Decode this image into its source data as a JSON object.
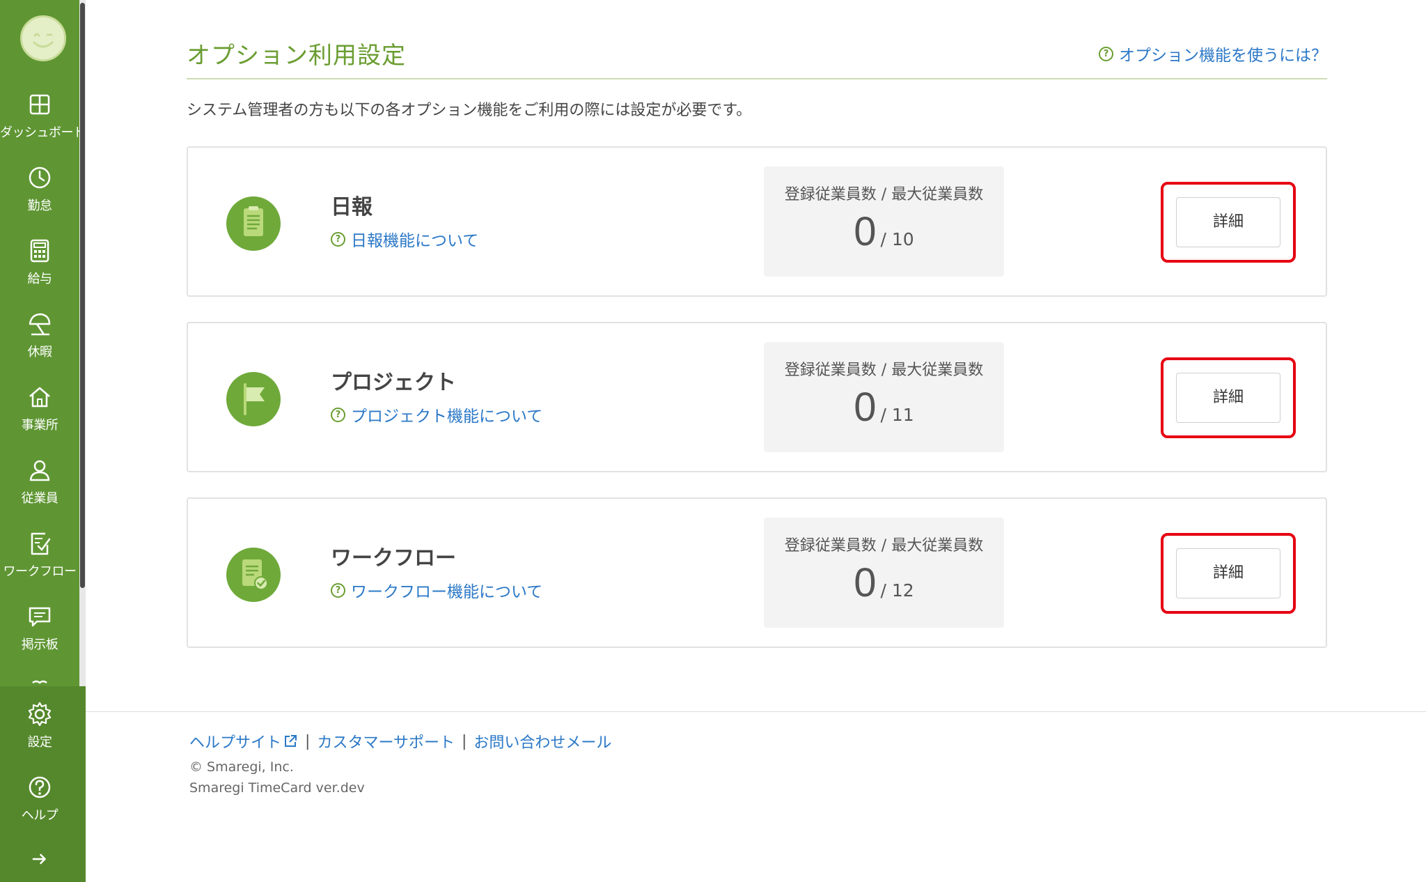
{
  "sidebar": {
    "items": [
      {
        "label": "ダッシュボード",
        "icon": "dashboard-icon"
      },
      {
        "label": "勤怠",
        "icon": "clock-icon"
      },
      {
        "label": "給与",
        "icon": "calculator-icon"
      },
      {
        "label": "休暇",
        "icon": "beach-umbrella-icon"
      },
      {
        "label": "事業所",
        "icon": "home-icon"
      },
      {
        "label": "従業員",
        "icon": "person-icon"
      },
      {
        "label": "ワークフロー",
        "icon": "workflow-check-icon"
      },
      {
        "label": "掲示板",
        "icon": "message-icon"
      }
    ],
    "bottom_items": [
      {
        "label": "設定",
        "icon": "gear-icon"
      },
      {
        "label": "ヘルプ",
        "icon": "help-icon"
      }
    ],
    "expand_icon": "arrow-right-icon",
    "colors": {
      "background": "#5f9633",
      "bottom": "#55882c"
    }
  },
  "header": {
    "title": "オプション利用設定",
    "help_link": "オプション機能を使うには？"
  },
  "intro": "システム管理者の方も以下の各オプション機能をご利用の際には設定が必要です。",
  "options": [
    {
      "name": "日報",
      "about": "日報機能について",
      "icon": "clipboard-icon",
      "stat_label": "登録従業員数 / 最大従業員数",
      "registered": "0",
      "max": "/ 10",
      "button": "詳細"
    },
    {
      "name": "プロジェクト",
      "about": "プロジェクト機能について",
      "icon": "flag-icon",
      "stat_label": "登録従業員数 / 最大従業員数",
      "registered": "0",
      "max": "/ 11",
      "button": "詳細"
    },
    {
      "name": "ワークフロー",
      "about": "ワークフロー機能について",
      "icon": "document-check-icon",
      "stat_label": "登録従業員数 / 最大従業員数",
      "registered": "0",
      "max": "/ 12",
      "button": "詳細"
    }
  ],
  "footer": {
    "help_site": "ヘルプサイト",
    "customer_support": "カスタマーサポート",
    "contact_mail": "お問い合わせメール",
    "separator": "|",
    "copyright": "© Smaregi, Inc.",
    "version": "Smaregi TimeCard ver.dev"
  },
  "colors": {
    "accent": "#6a9d31",
    "link": "#2b78c7",
    "highlight": "#e60012"
  }
}
